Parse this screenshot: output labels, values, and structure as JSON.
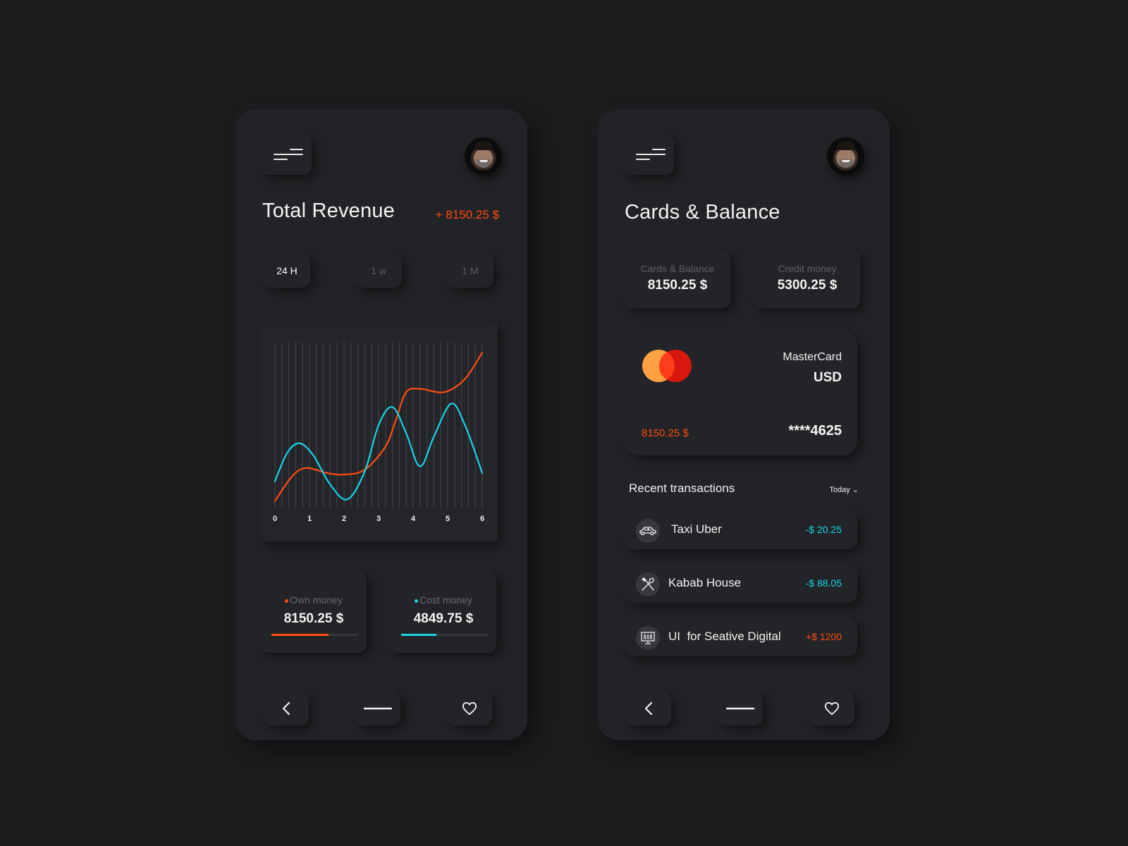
{
  "colors": {
    "orange": "#ff4b13",
    "cyan": "#18d3e6",
    "background": "#1b1c1e",
    "panel": "#222326"
  },
  "left_panel": {
    "menu_icon": "menu-icon",
    "avatar": "user-avatar",
    "title": "Total Revenue",
    "revenue_amount": "+ 8150.25 $",
    "tabs": [
      {
        "label": "24 H",
        "active": true
      },
      {
        "label": "1 w",
        "active": false
      },
      {
        "label": "1 M",
        "active": false
      }
    ],
    "stats": [
      {
        "label": "Own money",
        "value": "8150.25 $",
        "progress": 0.66,
        "color": "#ff4b13"
      },
      {
        "label": "Cost money",
        "value": "4849.75 $",
        "progress": 0.41,
        "color": "#18d3e6"
      }
    ],
    "nav": {
      "back_icon": "chevron-left-icon",
      "home_icon": "home-bar-icon",
      "favorite_icon": "heart-icon"
    }
  },
  "chart_data": {
    "type": "line",
    "title": "",
    "xlabel": "",
    "ylabel": "",
    "x_ticks": [
      "0",
      "1",
      "2",
      "3",
      "4",
      "5",
      "6"
    ],
    "xlim": [
      0,
      6
    ],
    "ylim": [
      0,
      100
    ],
    "grid": "vertical",
    "grid_line_count": 31,
    "series": [
      {
        "name": "Own money",
        "color": "#ff4b13",
        "x": [
          0,
          0.5,
          0.9,
          1.5,
          2.0,
          2.6,
          3.2,
          3.5,
          3.8,
          4.2,
          4.9,
          5.5,
          6.0
        ],
        "y": [
          4,
          19,
          24,
          21,
          20,
          23,
          37,
          53,
          70,
          72,
          70,
          78,
          94
        ]
      },
      {
        "name": "Cost money",
        "color": "#18d3e6",
        "x": [
          0,
          0.35,
          0.7,
          1.1,
          1.6,
          2.1,
          2.6,
          3.0,
          3.4,
          3.8,
          4.2,
          4.6,
          5.1,
          5.5,
          6.0
        ],
        "y": [
          16,
          33,
          39,
          32,
          14,
          5,
          22,
          50,
          61,
          45,
          25,
          43,
          63,
          50,
          21
        ]
      }
    ]
  },
  "right_panel": {
    "menu_icon": "menu-icon",
    "avatar": "user-avatar",
    "title": "Cards & Balance",
    "balances": [
      {
        "label": "Cards & Balance",
        "value": "8150.25 $"
      },
      {
        "label": "Credit money",
        "value": "5300.25 $"
      }
    ],
    "card": {
      "brand": "MasterCard",
      "currency": "USD",
      "balance": "8150.25 $",
      "number": "****4625",
      "logo_colors": [
        "#ffa043",
        "#d8170f",
        "#ff3d1a"
      ]
    },
    "recent": {
      "title": "Recent transactions",
      "filter": "Today ⌄"
    },
    "transactions": [
      {
        "icon": "car-icon",
        "name": "Taxi Uber",
        "amount": "-$ 20.25",
        "type": "debit"
      },
      {
        "icon": "utensils-icon",
        "name": "Kabab House",
        "amount": "-$ 88.05",
        "type": "debit"
      },
      {
        "icon": "monitor-design-icon",
        "name": "UI  for Seative Digital",
        "amount": "+$ 1200",
        "type": "credit"
      }
    ],
    "nav": {
      "back_icon": "chevron-left-icon",
      "home_icon": "home-bar-icon",
      "favorite_icon": "heart-icon"
    }
  }
}
